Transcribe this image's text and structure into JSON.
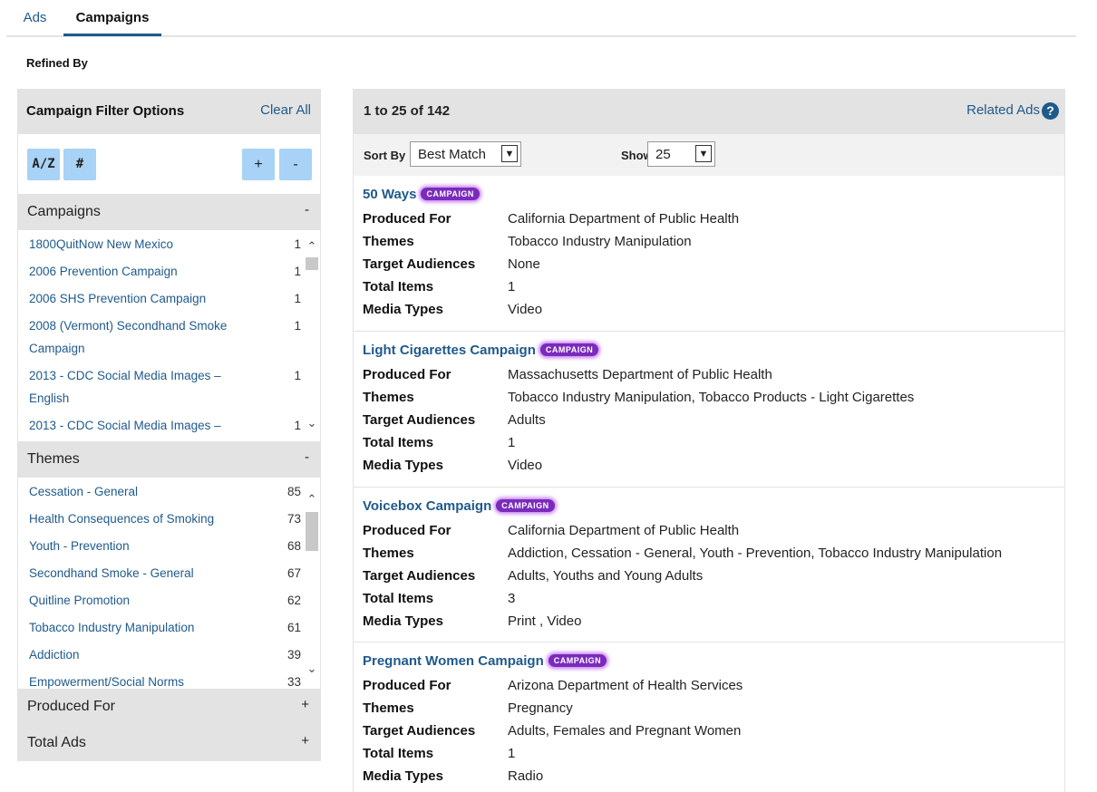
{
  "tabs": [
    {
      "label": "Ads",
      "active": false
    },
    {
      "label": "Campaigns",
      "active": true
    }
  ],
  "refined_by": "Refined By",
  "filter": {
    "title": "Campaign Filter Options",
    "clear_all": "Clear All",
    "buttons": {
      "az": "A/Z",
      "num": "#",
      "plus": "+",
      "minus": "-"
    },
    "sections": {
      "campaigns": {
        "label": "Campaigns",
        "toggle": "-",
        "items": [
          {
            "name": "1800QuitNow New Mexico",
            "count": "1"
          },
          {
            "name": "2006 Prevention Campaign",
            "count": "1"
          },
          {
            "name": "2006 SHS Prevention Campaign",
            "count": "1"
          },
          {
            "name": "2008 (Vermont) Secondhand Smoke Campaign",
            "count": "1"
          },
          {
            "name": "2013 - CDC Social Media Images – English",
            "count": "1"
          },
          {
            "name": "2013 - CDC Social Media Images –",
            "count": "1"
          }
        ]
      },
      "themes": {
        "label": "Themes",
        "toggle": "-",
        "items": [
          {
            "name": "Cessation - General",
            "count": "85"
          },
          {
            "name": "Health Consequences of Smoking",
            "count": "73"
          },
          {
            "name": "Youth - Prevention",
            "count": "68"
          },
          {
            "name": "Secondhand Smoke - General",
            "count": "67"
          },
          {
            "name": "Quitline Promotion",
            "count": "62"
          },
          {
            "name": "Tobacco Industry Manipulation",
            "count": "61"
          },
          {
            "name": "Addiction",
            "count": "39"
          },
          {
            "name": "Empowerment/Social Norms",
            "count": "33"
          }
        ]
      },
      "produced_for": {
        "label": "Produced For",
        "toggle": "+"
      },
      "total_ads": {
        "label": "Total Ads",
        "toggle": "+"
      }
    }
  },
  "results": {
    "count_text": "1 to 25 of 142",
    "related_ads": "Related Ads",
    "sort_label": "Sort By",
    "sort_value": "Best Match",
    "show_label": "Show",
    "show_value": "25",
    "field_labels": {
      "produced_for": "Produced For",
      "themes": "Themes",
      "target_audiences": "Target Audiences",
      "total_items": "Total Items",
      "media_types": "Media Types"
    },
    "badge": "CAMPAIGN",
    "cards": [
      {
        "title": "50 Ways",
        "produced_for": "California Department of Public Health",
        "themes": "Tobacco Industry Manipulation",
        "target_audiences": "None",
        "total_items": "1",
        "media_types": "Video"
      },
      {
        "title": "Light Cigarettes Campaign",
        "produced_for": "Massachusetts Department of Public Health",
        "themes": "Tobacco Industry Manipulation, Tobacco Products - Light Cigarettes",
        "target_audiences": "Adults",
        "total_items": "1",
        "media_types": "Video"
      },
      {
        "title": "Voicebox Campaign",
        "produced_for": "California Department of Public Health",
        "themes": "Addiction, Cessation - General, Youth - Prevention, Tobacco Industry Manipulation",
        "target_audiences": "Adults, Youths and Young Adults",
        "total_items": "3",
        "media_types": "Print , Video"
      },
      {
        "title": "Pregnant Women Campaign",
        "produced_for": "Arizona Department of Health Services",
        "themes": "Pregnancy",
        "target_audiences": "Adults, Females and Pregnant Women",
        "total_items": "1",
        "media_types": "Radio"
      }
    ]
  }
}
